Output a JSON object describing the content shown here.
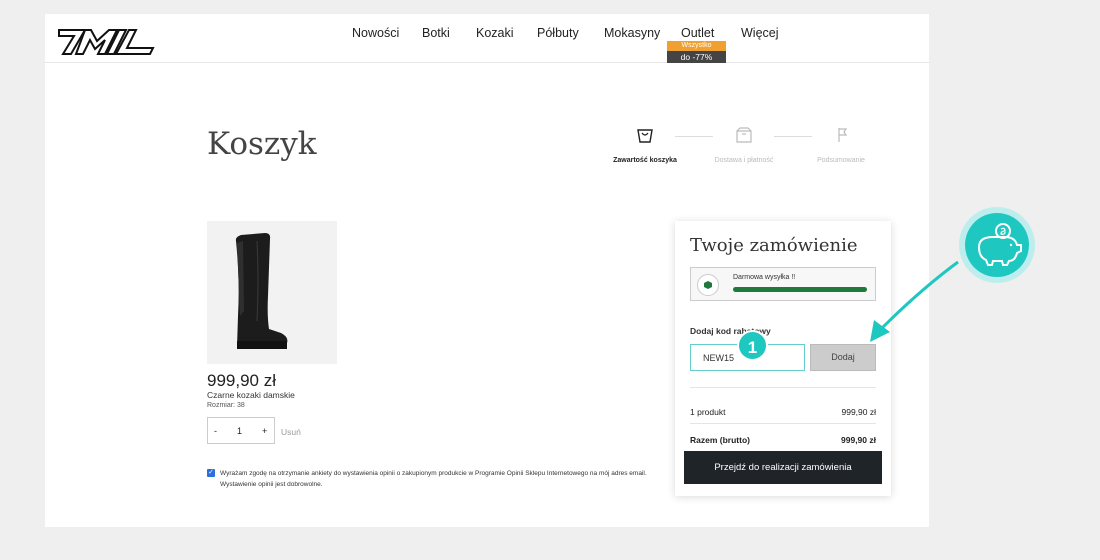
{
  "header": {
    "nav": [
      {
        "label": "Nowości"
      },
      {
        "label": "Botki"
      },
      {
        "label": "Kozaki"
      },
      {
        "label": "Półbuty"
      },
      {
        "label": "Mokasyny"
      },
      {
        "label": "Outlet"
      },
      {
        "label": "Więcej"
      }
    ],
    "outlet_badge_top": "Wszystko",
    "outlet_badge_bottom": "do -77%"
  },
  "page": {
    "title": "Koszyk",
    "steps": [
      {
        "label": "Zawartość koszyka",
        "active": true,
        "icon": "bag-icon"
      },
      {
        "label": "Dostawa i płatność",
        "active": false,
        "icon": "box-icon"
      },
      {
        "label": "Podsumowanie",
        "active": false,
        "icon": "flag-icon"
      }
    ]
  },
  "cart": {
    "item": {
      "price": "999,90 zł",
      "name": "Czarne kozaki damskie",
      "size": "Rozmiar: 38",
      "quantity": "1",
      "minus": "-",
      "plus": "+",
      "remove_label": "Usuń"
    },
    "consent": {
      "checked": true,
      "text": "Wyrażam zgodę na otrzymanie ankiety do wystawienia opinii o zakupionym produkcie w Programie Opinii Sklepu Internetowego na mój adres email. Wystawienie opinii jest dobrowolne."
    }
  },
  "summary": {
    "title": "Twoje zamówienie",
    "shipping_label": "Darmowa wysyłka !!",
    "shipping_progress": 1.0,
    "coupon_label": "Dodaj kod rabatowy",
    "coupon_value": "NEW15",
    "apply_label": "Dodaj",
    "rows": [
      {
        "label": "1 produkt",
        "value": "999,90 zł"
      },
      {
        "label": "Razem (brutto)",
        "value": "999,90 zł"
      }
    ],
    "checkout_label": "Przejdź do realizacji zamówienia"
  },
  "overlay": {
    "step_number": "1",
    "accent_color": "#1ec8c0",
    "icon": "piggy-bank-icon"
  }
}
